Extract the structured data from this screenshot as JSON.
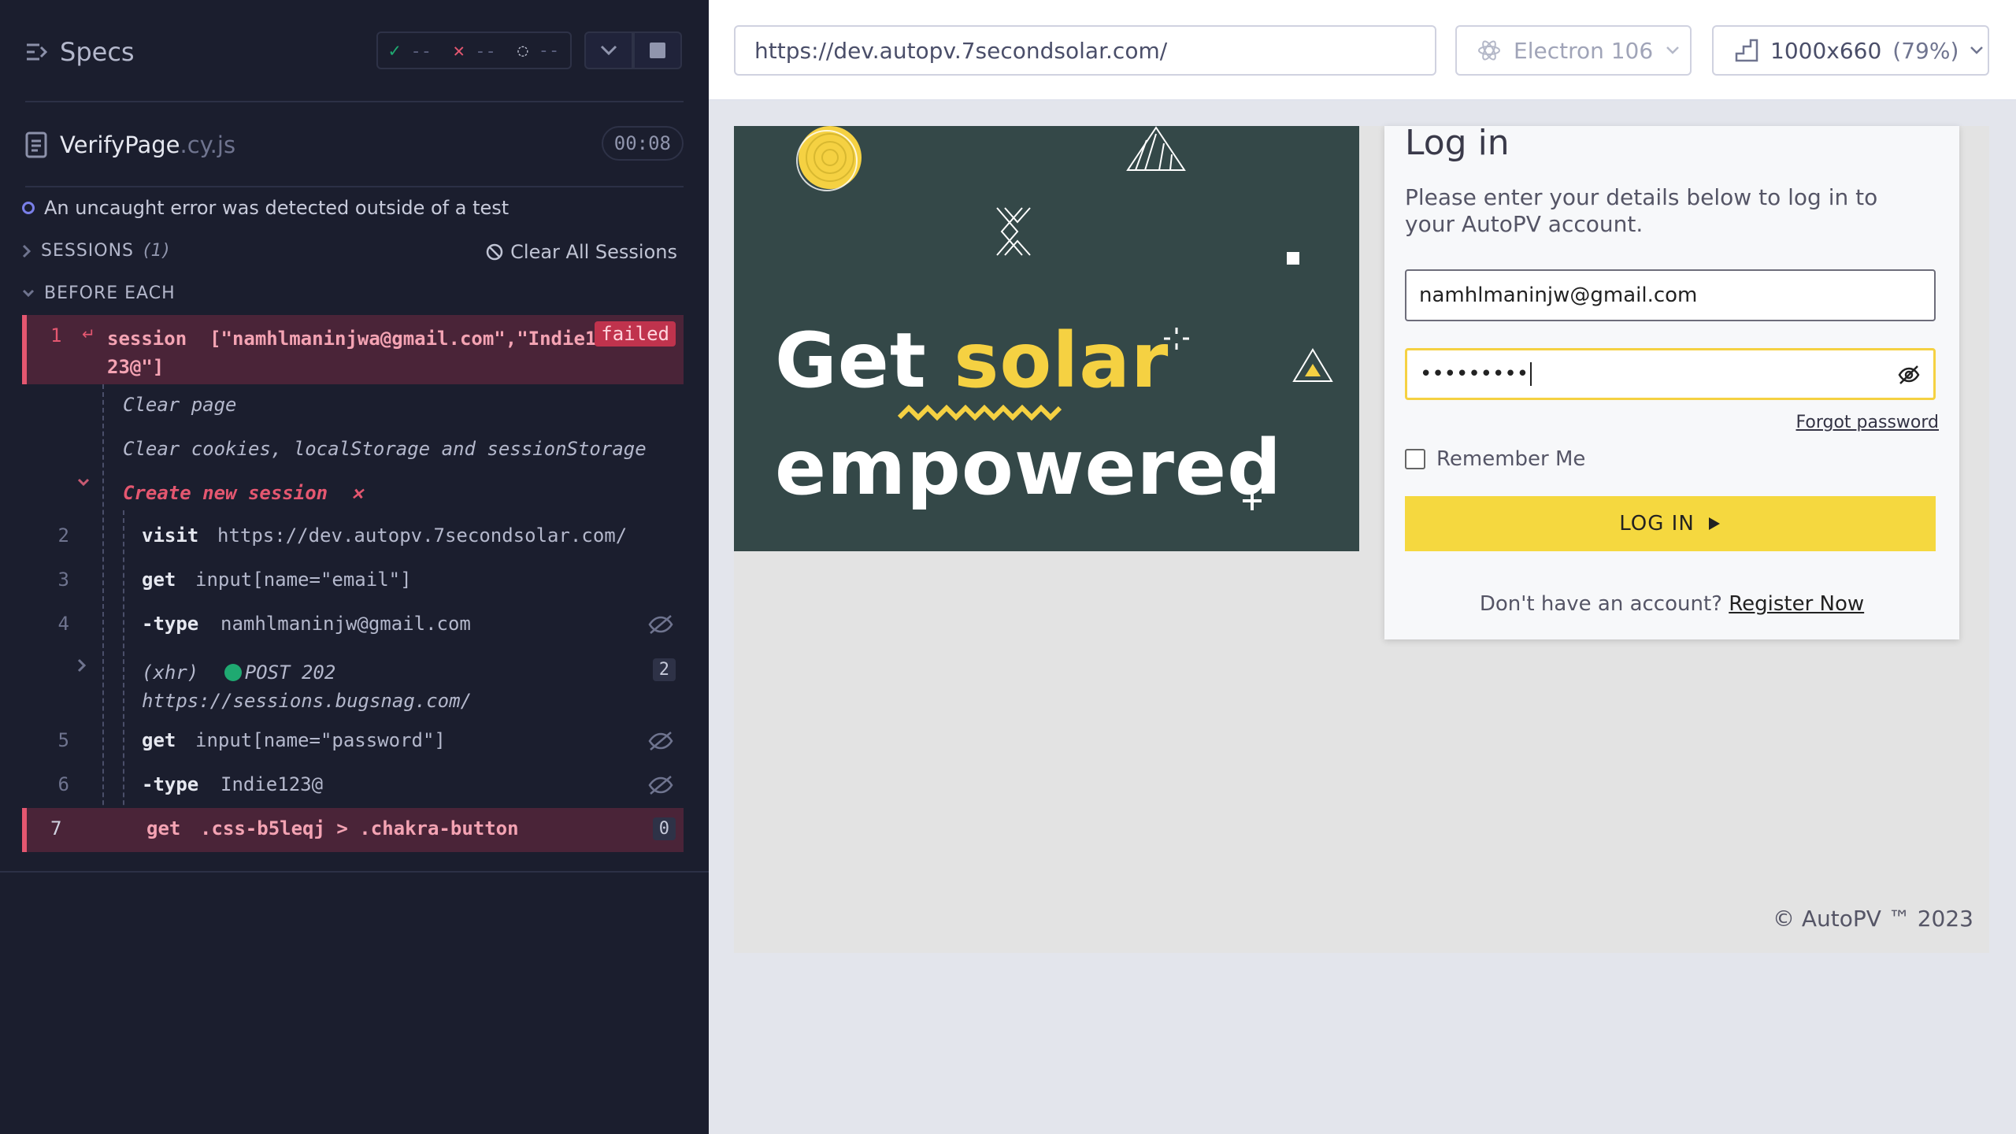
{
  "reporter": {
    "title": "Specs",
    "stats": {
      "passed": "--",
      "failed": "--",
      "pending": "--"
    },
    "spec": {
      "name": "VerifyPage",
      "ext": ".cy.js",
      "duration": "00:08"
    },
    "uncaught": "An uncaught error was detected outside of a test",
    "sessions": {
      "label": "SESSIONS",
      "count": "(1)",
      "clear": "Clear All Sessions"
    },
    "before_each": "BEFORE EACH",
    "session_cmd": {
      "num": "1",
      "name": "session",
      "args": "[\"namhlmaninjwa@gmail.com\",\"Indie1",
      "args2": "23@\"]",
      "status": "failed"
    },
    "clear_page": "Clear page",
    "clear_cookies": "Clear cookies, localStorage and sessionStorage",
    "create_session": "Create new session",
    "commands": [
      {
        "num": "2",
        "name": "visit",
        "arg": "https://dev.autopv.7secondsolar.com/"
      },
      {
        "num": "3",
        "name": "get",
        "arg": "input[name=\"email\"]"
      },
      {
        "num": "4",
        "name": "-type",
        "arg": "namhlmaninjw@gmail.com"
      },
      {
        "num": "5",
        "name": "get",
        "arg": "input[name=\"password\"]"
      },
      {
        "num": "6",
        "name": "-type",
        "arg": "Indie123@"
      },
      {
        "num": "7",
        "name": "get",
        "arg": ".css-b5leqj > .chakra-button",
        "count": "0"
      }
    ],
    "xhr": {
      "label": "(xhr)",
      "method": "POST 202",
      "url": "https://sessions.bugsnag.com/",
      "count": "2"
    }
  },
  "preview": {
    "url": "https://dev.autopv.7secondsolar.com/",
    "browser": "Electron 106",
    "viewport": "1000x660",
    "scale": "(79%)"
  },
  "app": {
    "hero": {
      "word1": "Get",
      "word2": "solar",
      "word3": "empowered"
    },
    "login_title": "Log in",
    "subtitle": "Please enter your details below to log in to your AutoPV account.",
    "email_value": "namhlmaninjw@gmail.com",
    "password_value": "•••••••••",
    "forgot": "Forgot password",
    "remember": "Remember Me",
    "login_button": "LOG IN",
    "no_account": "Don't have an account?",
    "register": "Register Now",
    "copyright": "© AutoPV ™ 2023"
  },
  "colors": {
    "reporter_bg": "#1b1e2e",
    "fail": "#e45770",
    "accent_yellow": "#f5d142",
    "hero_bg": "#344848"
  }
}
